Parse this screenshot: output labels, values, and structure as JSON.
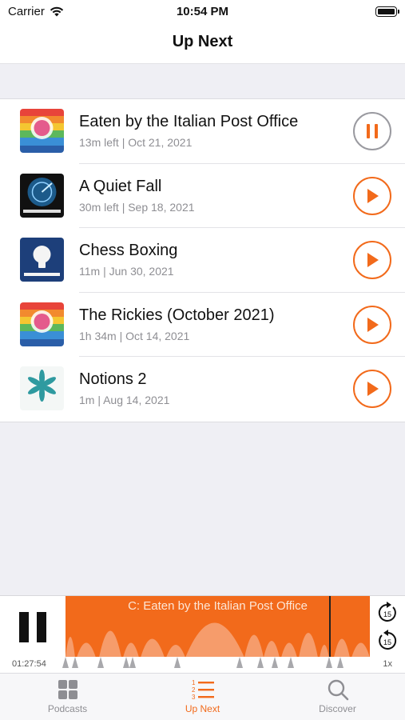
{
  "status_bar": {
    "carrier": "Carrier",
    "time": "10:54 PM"
  },
  "nav": {
    "title": "Up Next"
  },
  "episodes": [
    {
      "title": "Eaten by the Italian Post Office",
      "meta": "13m left | Oct 21, 2021",
      "art": "connected-artwork",
      "art_label": "CONNECTED",
      "state": "pause"
    },
    {
      "title": "A Quiet Fall",
      "meta": "30m left | Sep 18, 2021",
      "art": "under-the-radar-artwork",
      "art_label": "UNDER THE RADAR",
      "state": "play"
    },
    {
      "title": "Chess Boxing",
      "meta": "11m | Jun 30, 2021",
      "art": "ungeniused-artwork",
      "art_label": "UNGENIUSED",
      "state": "play"
    },
    {
      "title": "The Rickies (October 2021)",
      "meta": "1h 34m | Oct 14, 2021",
      "art": "connected-artwork",
      "art_label": "CONNECTED",
      "state": "play"
    },
    {
      "title": "Notions 2",
      "meta": "1m | Aug 14, 2021",
      "art": "finding-fresh-artwork",
      "art_label": "Finding Fresh",
      "state": "play"
    }
  ],
  "player": {
    "now_playing": "C: Eaten by the Italian Post Office",
    "elapsed": "01:27:54",
    "speed": "1x",
    "skip_forward": "15",
    "skip_back": "15",
    "progress": 0.87
  },
  "tabs": [
    {
      "label": "Podcasts",
      "icon": "grid-icon",
      "active": false
    },
    {
      "label": "Up Next",
      "icon": "numbered-list-icon",
      "active": true
    },
    {
      "label": "Discover",
      "icon": "search-icon",
      "active": false
    }
  ],
  "colors": {
    "accent": "#f26a1b",
    "background": "#efeff4"
  }
}
